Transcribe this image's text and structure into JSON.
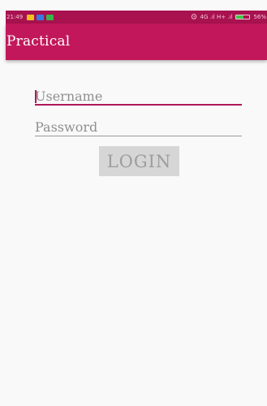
{
  "status_bar": {
    "time": "21:49",
    "network": "4G .ıl H+ .ıl",
    "battery_percent": "56%",
    "battery_level": 0.56,
    "colors": {
      "background": "#a8124f",
      "battery_fill": "#46c346"
    },
    "icons": [
      "image-notification-icon",
      "app-notification-icon",
      "message-notification-icon",
      "alarm-icon",
      "signal-icon",
      "battery-icon"
    ]
  },
  "app_bar": {
    "title": "Practical",
    "background": "#c2185b"
  },
  "form": {
    "username_placeholder": "Username",
    "password_placeholder": "Password",
    "login_label": "LOGIN",
    "accent": "#b0185a"
  }
}
